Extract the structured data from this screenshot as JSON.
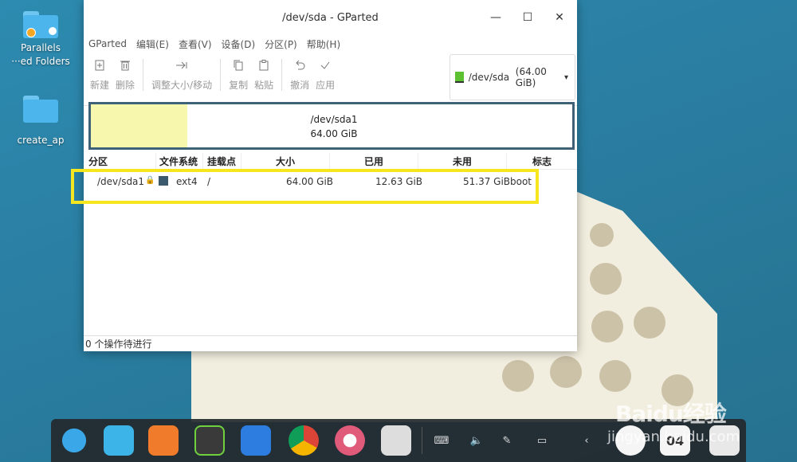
{
  "desktop": {
    "icons": [
      {
        "label": "Parallels\n···ed Folders"
      },
      {
        "label": "create_ap"
      }
    ]
  },
  "window": {
    "title": "/dev/sda - GParted",
    "controls": {
      "minimize": "—",
      "maximize": "☐",
      "close": "✕"
    },
    "menu": [
      "GParted",
      "编辑(E)",
      "查看(V)",
      "设备(D)",
      "分区(P)",
      "帮助(H)"
    ],
    "toolbar": {
      "new": "新建",
      "delete": "删除",
      "resize": "调整大小/移动",
      "copy": "复制",
      "paste": "粘贴",
      "undo": "撤消",
      "apply": "应用"
    },
    "device_select": {
      "device": "/dev/sda",
      "size": "(64.00 GiB)"
    },
    "diskmap": {
      "name": "/dev/sda1",
      "size": "64.00 GiB",
      "used_fraction": 0.2
    },
    "table": {
      "headers": [
        "分区",
        "文件系统",
        "挂载点",
        "大小",
        "已用",
        "未用",
        "标志"
      ],
      "rows": [
        {
          "partition": "/dev/sda1",
          "fs": "ext4",
          "mount": "/",
          "size": "64.00 GiB",
          "used": "12.63 GiB",
          "unused": "51.37 GiB",
          "flags": "boot"
        }
      ]
    },
    "status": "0 个操作待进行"
  },
  "dock": {
    "apps": [
      "deepin-launcher-icon",
      "file-manager-icon",
      "app-store-icon",
      "music-icon",
      "video-icon",
      "chrome-icon",
      "settings-icon",
      "disk-icon"
    ],
    "tray": [
      "keyboard-icon",
      "volume-icon",
      "pen-icon",
      "battery-icon",
      "chevron-left-icon"
    ],
    "clock": "04"
  },
  "watermark": {
    "line1": "Baidu经验",
    "line2": "jingyan.baidu.com"
  }
}
